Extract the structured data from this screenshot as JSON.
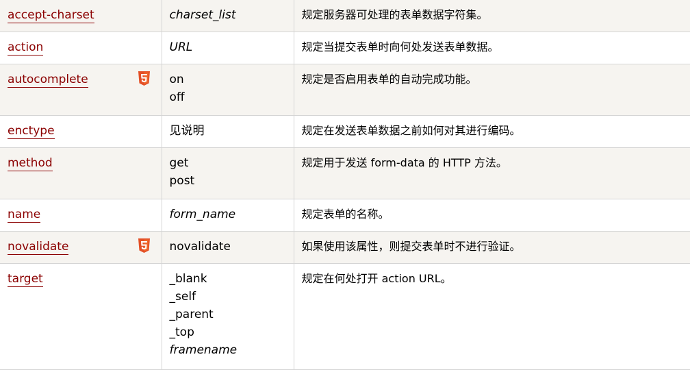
{
  "rows": [
    {
      "name": "accept-charset",
      "html5": false,
      "values": [
        {
          "text": "charset_list",
          "italic": true
        }
      ],
      "desc": "规定服务器可处理的表单数据字符集。",
      "height": 47
    },
    {
      "name": "action",
      "html5": false,
      "values": [
        {
          "text": "URL",
          "italic": true
        }
      ],
      "desc": "规定当提交表单时向何处发送表单数据。",
      "height": 47
    },
    {
      "name": "autocomplete",
      "html5": true,
      "values": [
        {
          "text": "on",
          "italic": false
        },
        {
          "text": "off",
          "italic": false
        }
      ],
      "desc": "规定是否启用表单的自动完成功能。",
      "height": 75
    },
    {
      "name": "enctype",
      "html5": false,
      "values": [
        {
          "text": "见说明",
          "italic": false
        }
      ],
      "desc": "规定在发送表单数据之前如何对其进行编码。",
      "height": 47
    },
    {
      "name": "method",
      "html5": false,
      "values": [
        {
          "text": "get",
          "italic": false
        },
        {
          "text": "post",
          "italic": false
        }
      ],
      "desc": "规定用于发送 form-data 的 HTTP 方法。",
      "height": 75
    },
    {
      "name": "name",
      "html5": false,
      "values": [
        {
          "text": "form_name",
          "italic": true
        }
      ],
      "desc": "规定表单的名称。",
      "height": 47
    },
    {
      "name": "novalidate",
      "html5": true,
      "values": [
        {
          "text": "novalidate",
          "italic": false
        }
      ],
      "desc": "如果使用该属性，则提交表单时不进行验证。",
      "height": 47
    },
    {
      "name": "target",
      "html5": false,
      "values": [
        {
          "text": "_blank",
          "italic": false
        },
        {
          "text": "_self",
          "italic": false
        },
        {
          "text": "_parent",
          "italic": false
        },
        {
          "text": "_top",
          "italic": false
        },
        {
          "text": "framename",
          "italic": true
        }
      ],
      "desc": "规定在何处打开 action URL。",
      "height": 155
    }
  ],
  "colors": {
    "link": "#8b0000",
    "stripe": "#f6f4f0",
    "border": "#d4d4d4",
    "html5_badge": "#e34f26"
  },
  "icons": {
    "html5": "html5-icon"
  }
}
